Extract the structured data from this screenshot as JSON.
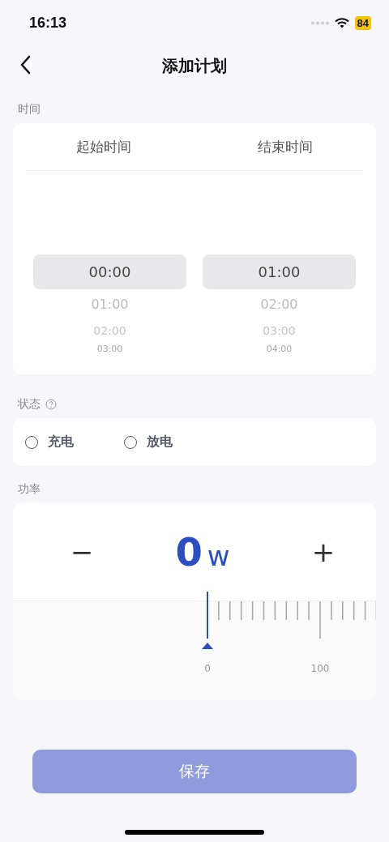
{
  "status_bar": {
    "time": "16:13",
    "battery": "84"
  },
  "nav": {
    "title": "添加计划"
  },
  "time_section": {
    "label": "时间",
    "columns": [
      {
        "header": "起始时间",
        "options": [
          {
            "label": "00:00",
            "selected": true
          },
          {
            "label": "01:00",
            "selected": false
          },
          {
            "label": "02:00",
            "selected": false
          },
          {
            "label": "03:00",
            "selected": false
          }
        ]
      },
      {
        "header": "结束时间",
        "options": [
          {
            "label": "01:00",
            "selected": true
          },
          {
            "label": "02:00",
            "selected": false
          },
          {
            "label": "03:00",
            "selected": false
          },
          {
            "label": "04:00",
            "selected": false
          }
        ]
      }
    ]
  },
  "state_section": {
    "label": "状态",
    "options": [
      {
        "label": "充电",
        "selected": false
      },
      {
        "label": "放电",
        "selected": false
      }
    ]
  },
  "power_section": {
    "label": "功率",
    "minus": "−",
    "plus": "+",
    "value": "0",
    "unit": "w",
    "ruler_labels": [
      "0",
      "100"
    ]
  },
  "save_button": {
    "label": "保存",
    "disabled": true
  }
}
